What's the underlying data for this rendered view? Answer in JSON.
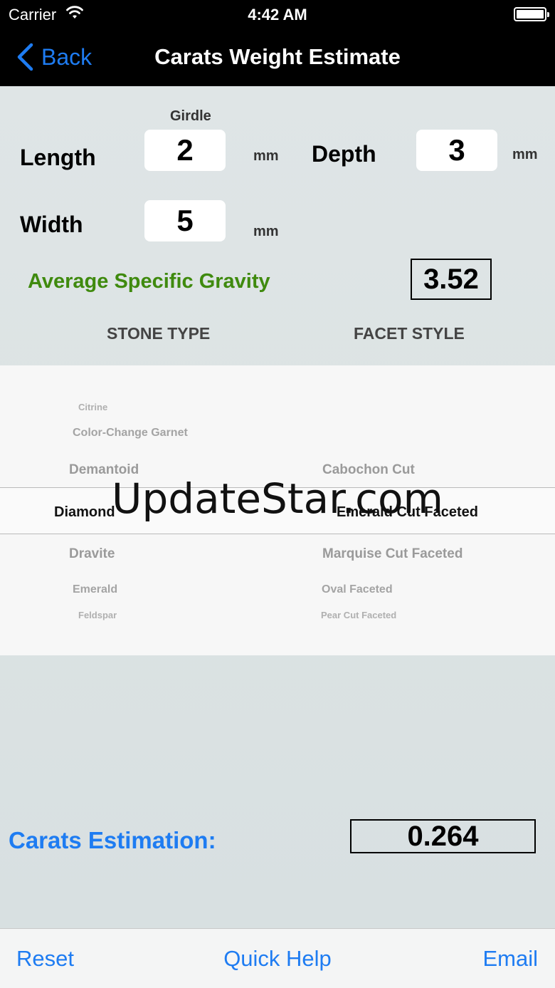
{
  "status": {
    "carrier": "Carrier",
    "time": "4:42 AM"
  },
  "nav": {
    "back_label": "Back",
    "title": "Carats Weight Estimate"
  },
  "form": {
    "girdle_label": "Girdle",
    "length_label": "Length",
    "length_value": "2",
    "depth_label": "Depth",
    "depth_value": "3",
    "width_label": "Width",
    "width_value": "5",
    "unit": "mm"
  },
  "specific_gravity": {
    "label": "Average Specific Gravity",
    "value": "3.52"
  },
  "columns": {
    "stone_type": "STONE TYPE",
    "facet_style": "FACET STYLE"
  },
  "picker": {
    "stone_types": [
      "Citrine",
      "Color-Change Garnet",
      "Demantoid",
      "Diamond",
      "Dravite",
      "Emerald",
      "Feldspar"
    ],
    "stone_selected_index": 3,
    "facet_styles": [
      "Cabochon Cut",
      "Emerald Cut Faceted",
      "Marquise Cut Faceted",
      "Oval Faceted",
      "Pear Cut Faceted"
    ],
    "facet_selected_index": 1
  },
  "watermark": "UpdateStar.com",
  "result": {
    "label": "Carats Estimation:",
    "value": "0.264"
  },
  "toolbar": {
    "reset": "Reset",
    "quick_help": "Quick Help",
    "email": "Email"
  },
  "colors": {
    "accent": "#1e7cf2",
    "gravity_label": "#3f8a0e",
    "background": "#dde3e4"
  },
  "icons": {
    "back": "chevron-left-icon",
    "wifi": "wifi-icon",
    "battery": "battery-icon"
  }
}
